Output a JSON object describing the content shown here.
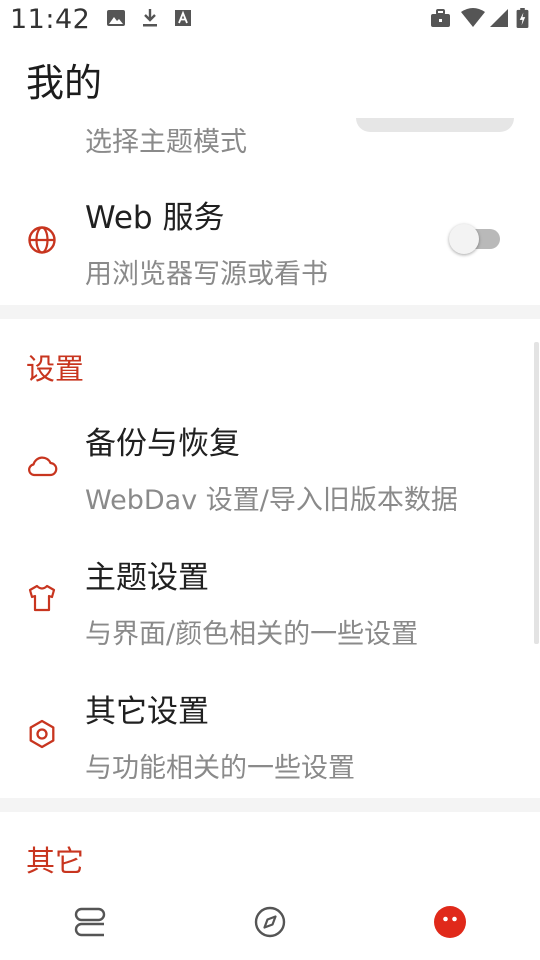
{
  "status_bar": {
    "time": "11:42",
    "left_icons": [
      "image-icon",
      "download-icon",
      "text-a-icon"
    ],
    "right_icons": [
      "briefcase-icon",
      "wifi-icon",
      "signal-icon",
      "battery-charging-icon"
    ]
  },
  "page": {
    "title": "我的"
  },
  "theme_mode": {
    "subtitle": "选择主题模式"
  },
  "web_service": {
    "title": "Web 服务",
    "subtitle": "用浏览器写源或看书",
    "icon": "globe-icon",
    "enabled": false
  },
  "settings_section": {
    "header": "设置",
    "items": [
      {
        "title": "备份与恢复",
        "subtitle": "WebDav 设置/导入旧版本数据",
        "icon": "cloud-icon"
      },
      {
        "title": "主题设置",
        "subtitle": "与界面/颜色相关的一些设置",
        "icon": "shirt-icon"
      },
      {
        "title": "其它设置",
        "subtitle": "与功能相关的一些设置",
        "icon": "hexagon-settings-icon"
      }
    ]
  },
  "other_section": {
    "header": "其它"
  },
  "bottom_nav": {
    "items": [
      {
        "icon": "bookshelf-icon",
        "active": false
      },
      {
        "icon": "compass-icon",
        "active": false
      },
      {
        "icon": "my-face-icon",
        "active": true
      }
    ]
  },
  "colors": {
    "accent": "#c8351f",
    "active_nav": "#e0291a",
    "subtitle": "#8a8a8a",
    "divider": "#f4f4f4"
  }
}
